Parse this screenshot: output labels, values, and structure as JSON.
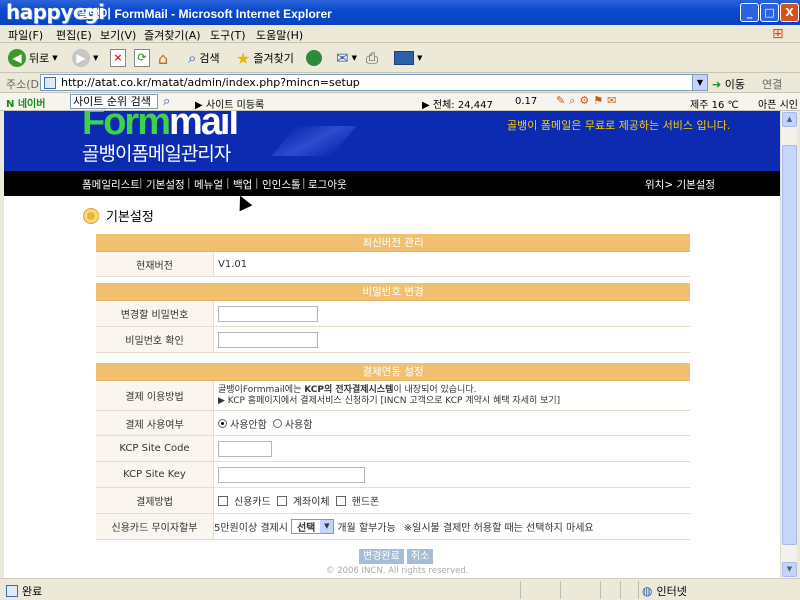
{
  "window": {
    "title": "골뱅이 FormMail - Microsoft Internet Explorer",
    "watermark": "happycgi",
    "min_label": "_",
    "max_label": "□",
    "close_label": "X"
  },
  "menu": [
    "파일(F)",
    "편집(E)",
    "보기(V)",
    "즐겨찾기(A)",
    "도구(T)",
    "도움말(H)"
  ],
  "toolbar": {
    "back": "뒤로",
    "search": "검색",
    "favorites": "즐겨찾기"
  },
  "address": {
    "label": "주소(D)",
    "url": "http://atat.co.kr/matat/admin/index.php?mincn=setup",
    "go": "이동",
    "links": "연결"
  },
  "naverbar": {
    "brand": "N 네이버",
    "search_value": "사이트 순위 검색",
    "site_ranking": "▶ 사이트 미등록",
    "total": "▶ 전체: 24,447",
    "rating": "0.17",
    "weather": "제주 16 ℃",
    "beautiful": "아픈 시인"
  },
  "banner": {
    "logo_form": "Form",
    "logo_mail": "mail",
    "korean_title": "골뱅이폼메일관리자",
    "tagline": "골뱅이 폼메일은 무료로 제공하는 서비스 입니다."
  },
  "nav": {
    "items": [
      "폼메일리스트",
      "기본설정",
      "메뉴얼",
      "백업",
      "인인스톨",
      "로그아웃"
    ],
    "location": "위치> 기본설정"
  },
  "page_title": "기본설정",
  "sections": {
    "version": {
      "header": "최신버전 관리",
      "current_label": "현재버전",
      "current_value": "V1.01"
    },
    "password": {
      "header": "비밀번호 변경",
      "new_label": "변경할 비밀번호",
      "new_value": "",
      "confirm_label": "비밀번호 확인",
      "confirm_value": ""
    },
    "payment": {
      "header": "결제연동 설정",
      "method_label": "결제 이용방법",
      "method_line1_a": "골뱅이Formmail에는 ",
      "method_line1_b": "KCP의 전자결제시스템",
      "method_line1_c": "이 내장되어 있습니다.",
      "method_line2": "▶ KCP 홈페이지에서 결제서비스 신청하기 [INCN 고객으로 KCP 계약시 혜택 자세히 보기]",
      "use_label": "결제 사용여부",
      "use_options": [
        "사용안함",
        "사용함"
      ],
      "use_selected": "사용안함",
      "site_code_label": "KCP Site Code",
      "site_code_value": "",
      "site_key_label": "KCP Site Key",
      "site_key_value": "",
      "pay_method_label": "결제방법",
      "pay_methods": [
        "신용카드",
        "계좌이체",
        "핸드폰"
      ],
      "installment_label": "신용카드 무이자할부",
      "installment_prefix": "5만원이상 결제시",
      "installment_select": "선택",
      "installment_suffix": "개월 할부가능",
      "installment_note": "※일시불 결제만 허용할 때는 선택하지 마세요"
    }
  },
  "buttons": {
    "save": "변경완료",
    "cancel": "취소"
  },
  "copyright": "© 2006 INCN. All rights reserved.",
  "status": {
    "left": "완료",
    "zone": "인터넷"
  }
}
